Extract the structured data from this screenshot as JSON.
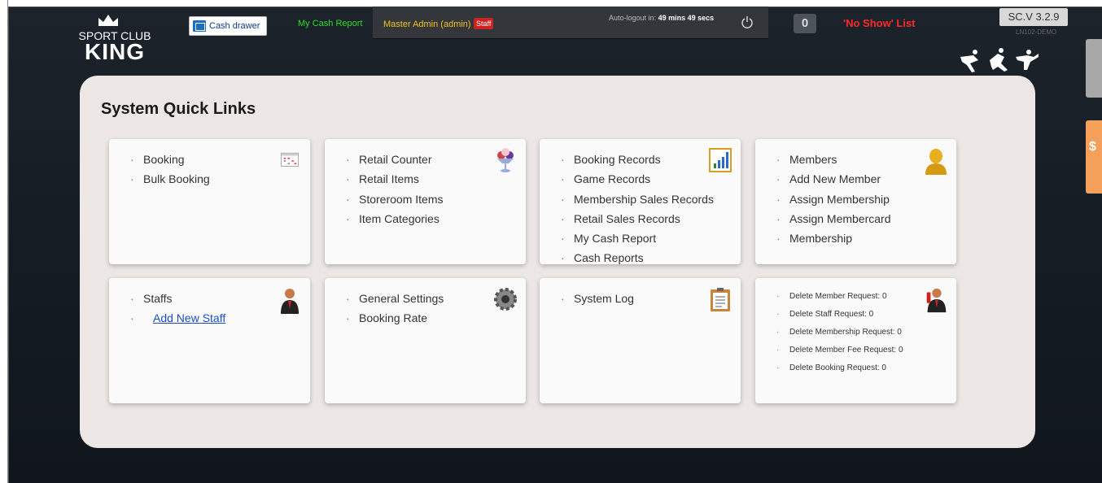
{
  "header": {
    "logo_sport": "SPORT CLUB",
    "logo_king": "KING",
    "cash_drawer_label": "Cash drawer",
    "my_cash_report_label": "My Cash Report",
    "admin_name": "Master Admin (admin)",
    "staff_badge": "Staff",
    "autologout_prefix": "Auto-logout in:",
    "autologout_mins": "49 mins",
    "autologout_secs": "49 secs",
    "notification_count": "0",
    "no_show_label": "'No Show' List",
    "version": "SC.V 3.2.9",
    "device_id": "LN102-DEMO"
  },
  "side_tabs": {
    "money_label": "$"
  },
  "panel": {
    "title": "System Quick Links",
    "cards": [
      {
        "items": [
          "Booking",
          "Bulk Booking"
        ],
        "icon": "calendar-icon"
      },
      {
        "items": [
          "Retail Counter",
          "Retail Items",
          "Storeroom Items",
          "Item Categories"
        ],
        "icon": "ice-cream-icon"
      },
      {
        "items": [
          "Booking Records",
          "Game Records",
          "Membership Sales Records",
          "Retail Sales Records",
          "My Cash Report",
          "Cash Reports"
        ],
        "icon": "bar-chart-icon"
      },
      {
        "items": [
          "Members",
          "Add New Member",
          "Assign Membership",
          "Assign Membercard",
          "Membership"
        ],
        "icon": "member-icon"
      },
      {
        "items": [
          "Staffs"
        ],
        "link": "Add New Staff",
        "icon": "staff-icon"
      },
      {
        "items": [
          "General Settings",
          "Booking Rate"
        ],
        "icon": "gear-icon"
      },
      {
        "items": [
          "System Log"
        ],
        "icon": "clipboard-icon"
      },
      {
        "items": [
          "Delete Member Request: 0",
          "Delete Staff Request: 0",
          "Delete Membership Request: 0",
          "Delete Member Fee Request: 0",
          "Delete Booking Request: 0"
        ],
        "icon": "request-icon"
      }
    ]
  }
}
